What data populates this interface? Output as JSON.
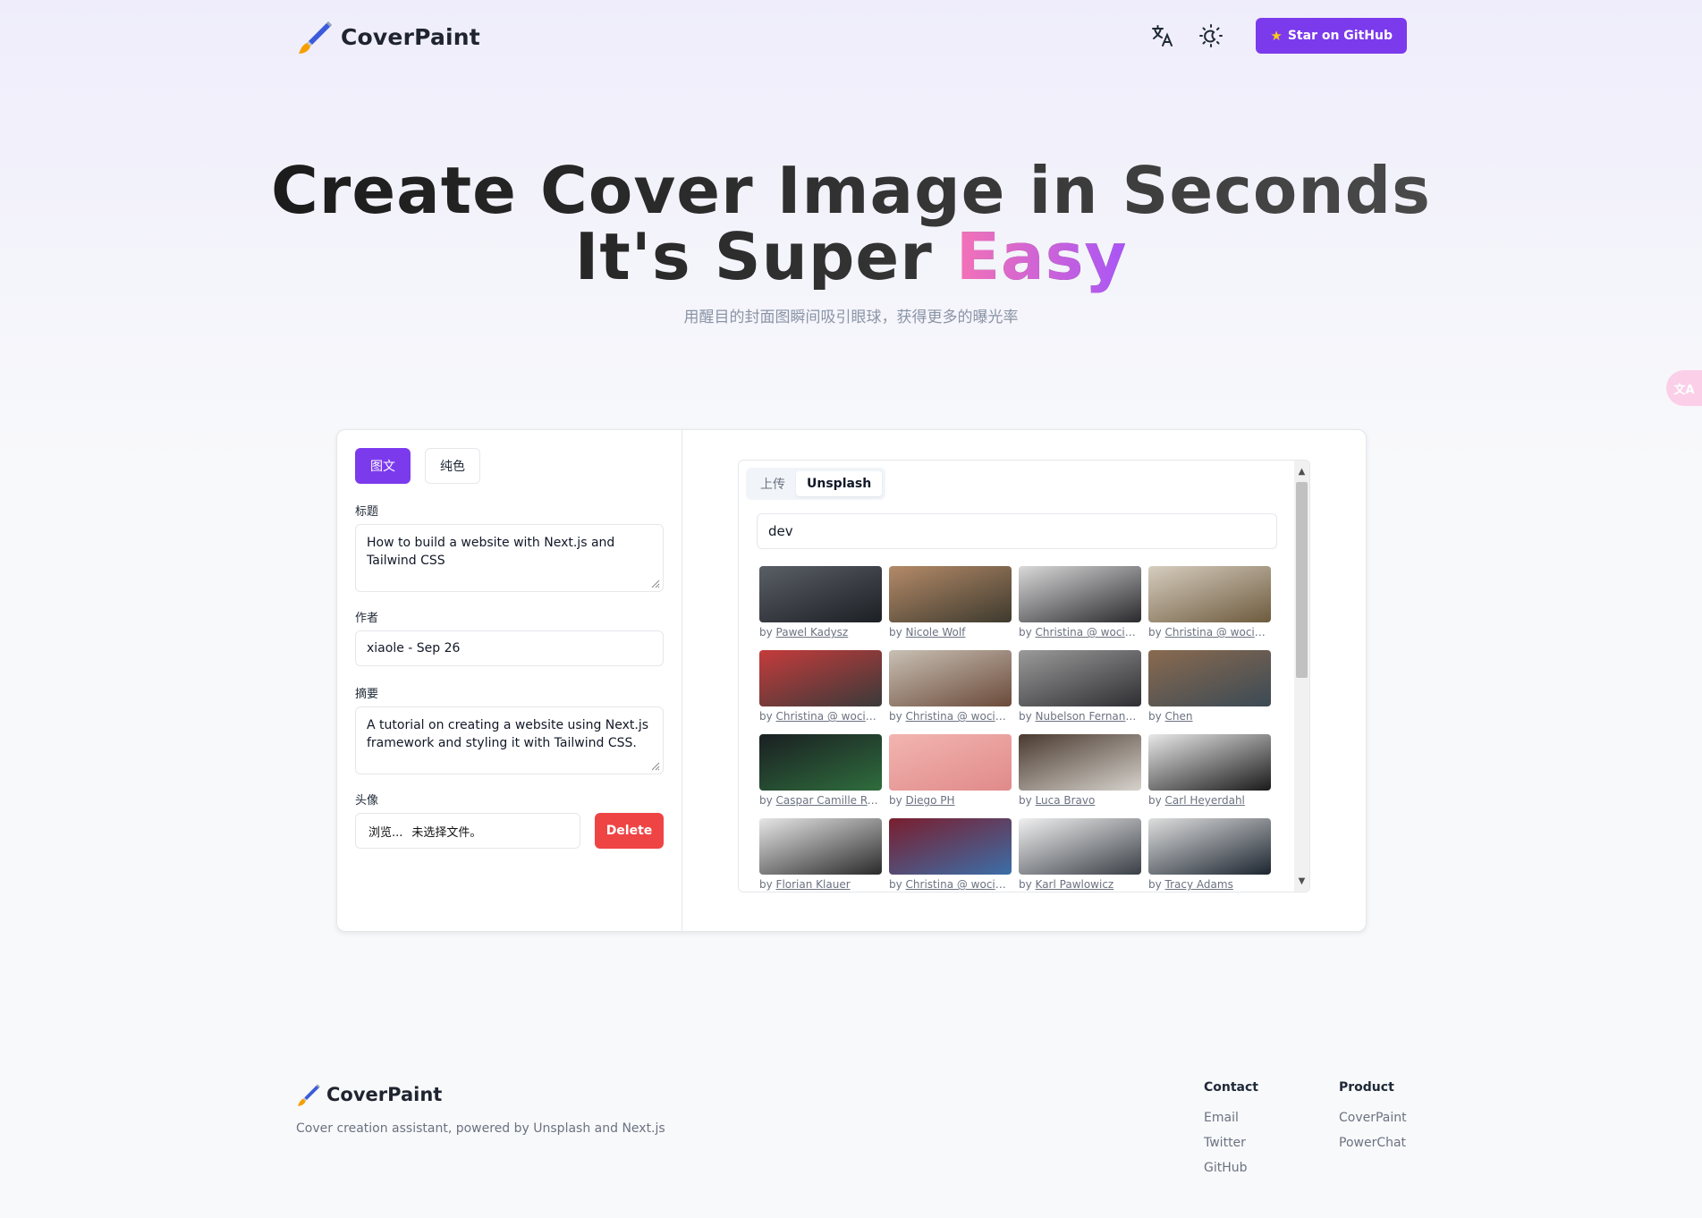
{
  "header": {
    "logo_text": "CoverPaint",
    "github_label": "Star on GitHub"
  },
  "hero": {
    "line1": "Create Cover Image in Seconds",
    "line2_prefix": "It's Super ",
    "line2_highlight": "Easy",
    "subtitle": "用醒目的封面图瞬间吸引眼球，获得更多的曝光率"
  },
  "editor": {
    "tabs": [
      {
        "label": "图文",
        "active": true
      },
      {
        "label": "纯色",
        "active": false
      }
    ],
    "title_label": "标题",
    "title_value": "How to build a website with Next.js and Tailwind CSS",
    "author_label": "作者",
    "author_value": "xiaole - Sep 26",
    "summary_label": "摘要",
    "summary_value": "A tutorial on creating a website using Next.js framework and styling it with Tailwind CSS.",
    "avatar_label": "头像",
    "file_button": "浏览...",
    "file_status": "未选择文件。",
    "delete_label": "Delete"
  },
  "images_panel": {
    "tabs": [
      {
        "label": "上传",
        "active": false
      },
      {
        "label": "Unsplash",
        "active": true
      }
    ],
    "search_value": "dev",
    "by_prefix": "by",
    "photos": [
      {
        "author": "Pawel Kadysz",
        "colors": [
          "#5a5f66",
          "#1c1f24"
        ]
      },
      {
        "author": "Nicole Wolf",
        "colors": [
          "#b48a68",
          "#3e3a2e"
        ]
      },
      {
        "author": "Christina @ wocintechchat.com",
        "colors": [
          "#d9d9d9",
          "#2a2a2e"
        ]
      },
      {
        "author": "Christina @ wocintechchat.com",
        "colors": [
          "#d6cdbf",
          "#6e5b3e"
        ]
      },
      {
        "author": "Christina @ wocintechchat.com",
        "colors": [
          "#c53b3b",
          "#3a3a3a"
        ]
      },
      {
        "author": "Christina @ wocintechchat.com",
        "colors": [
          "#c8c0b4",
          "#6b4a3a"
        ]
      },
      {
        "author": "Nubelson Fernandes",
        "colors": [
          "#9a9a9a",
          "#2f2f33"
        ]
      },
      {
        "author": "Chen",
        "colors": [
          "#8a6a4f",
          "#3b4a55"
        ]
      },
      {
        "author": "Caspar Camille Rubin",
        "colors": [
          "#1a1f22",
          "#2f6d3d"
        ]
      },
      {
        "author": "Diego PH",
        "colors": [
          "#f2b5b0",
          "#e08a8a"
        ]
      },
      {
        "author": "Luca Bravo",
        "colors": [
          "#4a3a30",
          "#d6d2cc"
        ]
      },
      {
        "author": "Carl Heyerdahl",
        "colors": [
          "#e8e8e8",
          "#1a1a1a"
        ]
      },
      {
        "author": "Florian Klauer",
        "colors": [
          "#e6e6e6",
          "#2a2a2a"
        ]
      },
      {
        "author": "Christina @ wocintechchat.com",
        "colors": [
          "#7a1e2e",
          "#3b6ea8"
        ]
      },
      {
        "author": "Karl Pawlowicz",
        "colors": [
          "#f0f0f0",
          "#3a3f46"
        ]
      },
      {
        "author": "Tracy Adams",
        "colors": [
          "#dedede",
          "#1c2530"
        ]
      }
    ]
  },
  "footer": {
    "logo_text": "CoverPaint",
    "description": "Cover creation assistant, powered by Unsplash and Next.js",
    "contact_title": "Contact",
    "contact_links": [
      "Email",
      "Twitter",
      "GitHub"
    ],
    "product_title": "Product",
    "product_links": [
      "CoverPaint",
      "PowerChat"
    ]
  },
  "colors": {
    "accent": "#7c3aed",
    "danger": "#ef4444"
  }
}
